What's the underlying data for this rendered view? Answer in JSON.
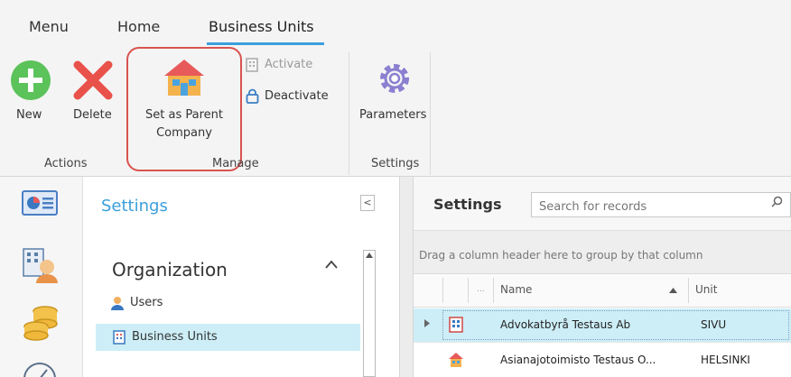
{
  "ribbon": {
    "tabs": [
      "Menu",
      "Home",
      "Business Units"
    ],
    "buttons": {
      "new": "New",
      "delete": "Delete",
      "set_parent_line1": "Set as Parent",
      "set_parent_line2": "Company",
      "activate": "Activate",
      "deactivate": "Deactivate",
      "parameters": "Parameters"
    },
    "groups": {
      "actions": "Actions",
      "manage": "Manage",
      "settings": "Settings"
    }
  },
  "nav": {
    "title": "Settings",
    "collapse_glyph": "<",
    "section_title": "Organization",
    "items": [
      "Users",
      "Business Units"
    ]
  },
  "grid": {
    "title": "Settings",
    "search_placeholder": "Search for records",
    "group_hint": "Drag a column header here to group by that column",
    "columns": {
      "ellipsis": "...",
      "name": "Name",
      "unit": "Unit"
    },
    "rows": [
      {
        "name": "Advokatbyrå Testaus Ab",
        "unit": "SIVU"
      },
      {
        "name": "Asianajotoimisto Testaus O...",
        "unit": "HELSINKI"
      }
    ]
  },
  "colors": {
    "accent": "#3a9fdc",
    "highlight_border": "#d9534f",
    "selection": "#cdeef7",
    "new_green": "#5cc25a",
    "delete_red": "#e8524a"
  }
}
